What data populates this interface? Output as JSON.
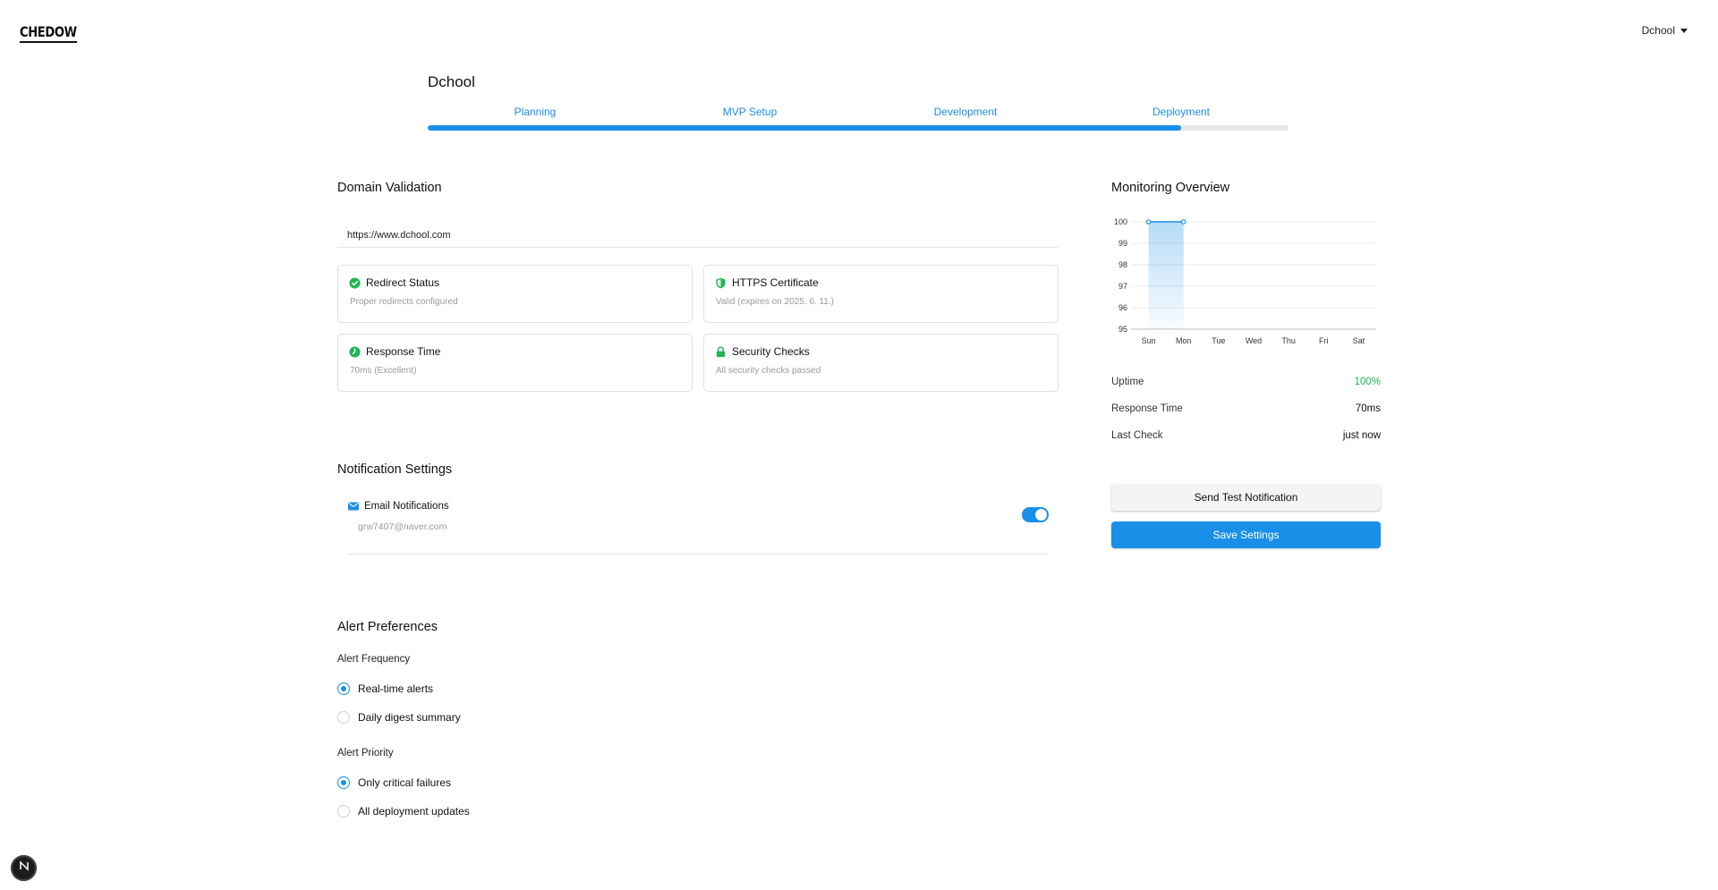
{
  "header": {
    "logo": "CHEDOW",
    "project_menu": "Dchool"
  },
  "project": {
    "title": "Dchool",
    "steps": [
      "Planning",
      "MVP Setup",
      "Development",
      "Deployment"
    ],
    "progress_percent": 87.5
  },
  "domain_validation": {
    "title": "Domain Validation",
    "url": "https://www.dchool.com",
    "cards": [
      {
        "title": "Redirect Status",
        "desc": "Proper redirects configured",
        "icon": "check-circle-icon"
      },
      {
        "title": "HTTPS Certificate",
        "desc": "Valid (expires on 2025. 6. 11.)",
        "icon": "shield-check-icon"
      },
      {
        "title": "Response Time",
        "desc": "70ms (Excellent)",
        "icon": "clock-check-icon"
      },
      {
        "title": "Security Checks",
        "desc": "All security checks passed",
        "icon": "lock-icon"
      }
    ]
  },
  "notification_settings": {
    "title": "Notification Settings",
    "email_label": "Email Notifications",
    "email_address": "grw7407@naver.com",
    "email_enabled": true
  },
  "alert_preferences": {
    "title": "Alert Preferences",
    "frequency_label": "Alert Frequency",
    "frequency_options": [
      "Real-time alerts",
      "Daily digest summary"
    ],
    "frequency_selected": 0,
    "priority_label": "Alert Priority",
    "priority_options": [
      "Only critical failures",
      "All deployment updates"
    ],
    "priority_selected": 0
  },
  "monitoring": {
    "title": "Monitoring Overview",
    "metrics": [
      {
        "label": "Uptime",
        "value": "100%"
      },
      {
        "label": "Response Time",
        "value": "70ms"
      },
      {
        "label": "Last Check",
        "value": "just now"
      }
    ],
    "send_test_label": "Send Test Notification",
    "save_label": "Save Settings"
  },
  "colors": {
    "accent": "#1a8fe8",
    "success": "#22b455"
  },
  "chart_data": {
    "type": "area",
    "categories": [
      "Sun",
      "Mon",
      "Tue",
      "Wed",
      "Thu",
      "Fri",
      "Sat"
    ],
    "values": [
      100,
      100,
      null,
      null,
      null,
      null,
      null
    ],
    "yticks": [
      100,
      99,
      98,
      97,
      96,
      95
    ],
    "ylim": [
      95,
      100
    ],
    "grid": true
  }
}
